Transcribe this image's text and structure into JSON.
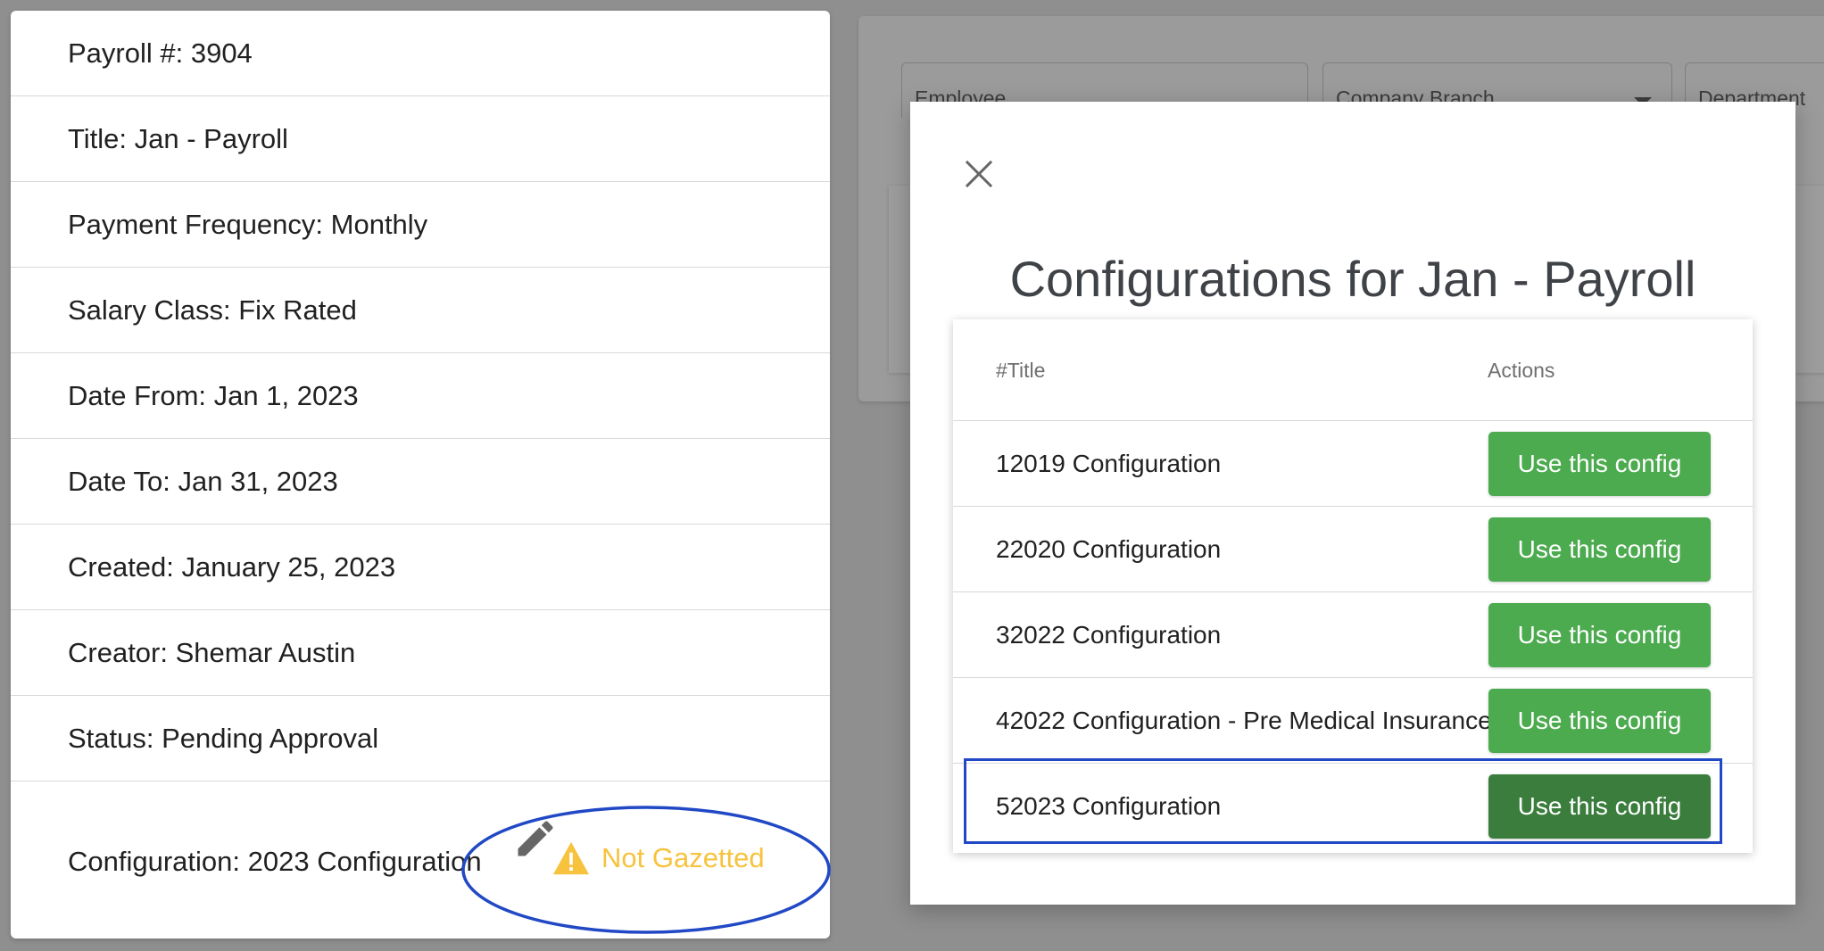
{
  "details": {
    "rows": [
      "Payroll #: 3904",
      "Title: Jan - Payroll",
      "Payment Frequency: Monthly",
      "Salary Class: Fix Rated",
      "Date From: Jan 1, 2023",
      "Date To: Jan 31, 2023",
      "Created: January 25, 2023",
      "Creator: Shemar Austin",
      "Status: Pending Approval"
    ],
    "configuration_label": "Configuration: 2023 Configuration",
    "gazette_status": "Not Gazetted",
    "gazette_status_color": "#f7c23d",
    "edit_icon": "pencil-icon",
    "warning_icon": "warning-triangle-icon"
  },
  "background_filters": {
    "fields": [
      "Employee",
      "Company Branch",
      "Department"
    ]
  },
  "modal": {
    "title": "Configurations for Jan - Payroll",
    "close_icon": "close-icon",
    "table": {
      "headers": [
        "#Title",
        "Actions"
      ],
      "rows": [
        {
          "title": "12019 Configuration",
          "action": "Use this config"
        },
        {
          "title": "22020 Configuration",
          "action": "Use this config"
        },
        {
          "title": "32022 Configuration",
          "action": "Use this config"
        },
        {
          "title": "42022 Configuration - Pre Medical Insurance",
          "action": "Use this config"
        },
        {
          "title": "52023 Configuration",
          "action": "Use this config"
        }
      ],
      "selected_row": "52023 Configuration"
    }
  },
  "colors": {
    "button_green": "#4caa4f",
    "button_green_active": "#3a7d3c",
    "annotation_blue": "#2148c5",
    "overlay_grey": "#8f8f8f"
  }
}
